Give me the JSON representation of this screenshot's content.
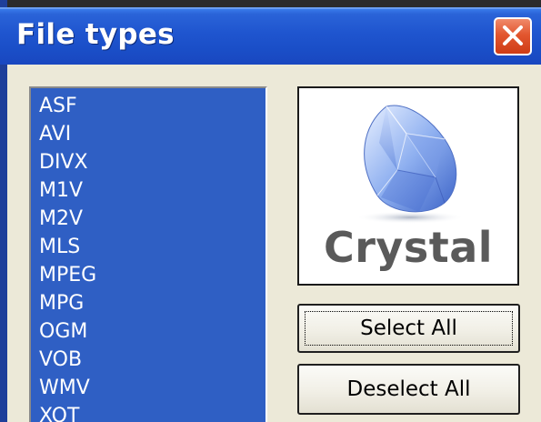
{
  "window": {
    "title": "File types",
    "close_icon": "close-x-icon",
    "accent_color": "#1f55cf",
    "close_color": "#e2562f"
  },
  "file_list": {
    "items": [
      "ASF",
      "AVI",
      "DIVX",
      "M1V",
      "M2V",
      "MLS",
      "MPEG",
      "MPG",
      "OGM",
      "VOB",
      "WMV",
      "XOT"
    ],
    "selection_color": "#2f5fc4"
  },
  "logo": {
    "text": "Crystal",
    "icon": "crystal-gem-icon"
  },
  "buttons": {
    "select_all": "Select All",
    "deselect_all": "Deselect All"
  }
}
